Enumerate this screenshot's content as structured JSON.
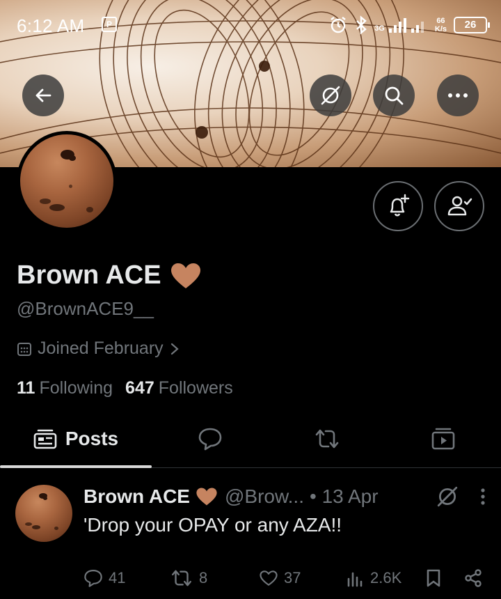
{
  "status_bar": {
    "time": "6:12 AM",
    "sim_badge": "P",
    "network": "3G",
    "speed_value": "66",
    "speed_unit": "K/s",
    "battery": "26"
  },
  "profile": {
    "name": "Brown ACE",
    "name_emoji": "🤎",
    "handle": "@BrownACE9__",
    "joined": "Joined February",
    "following_count": "11",
    "following_label": "Following",
    "followers_count": "647",
    "followers_label": "Followers"
  },
  "tabs": [
    {
      "label": "Posts",
      "icon": "posts-icon",
      "active": true
    },
    {
      "label": "",
      "icon": "replies-icon",
      "active": false
    },
    {
      "label": "",
      "icon": "reposts-icon",
      "active": false
    },
    {
      "label": "",
      "icon": "media-icon",
      "active": false
    }
  ],
  "post": {
    "author": "Brown ACE",
    "author_emoji": "🤎",
    "handle": "@Brow...",
    "date": "• 13 Apr",
    "text": "'Drop your OPAY or any AZA!!",
    "replies": "41",
    "reposts": "8",
    "likes": "37",
    "views": "2.6K"
  },
  "colors": {
    "background": "#000000",
    "text_primary": "#e7e9ea",
    "text_secondary": "#71767b",
    "banner_brown": "#7a4a2a",
    "heart": "#c68460"
  }
}
